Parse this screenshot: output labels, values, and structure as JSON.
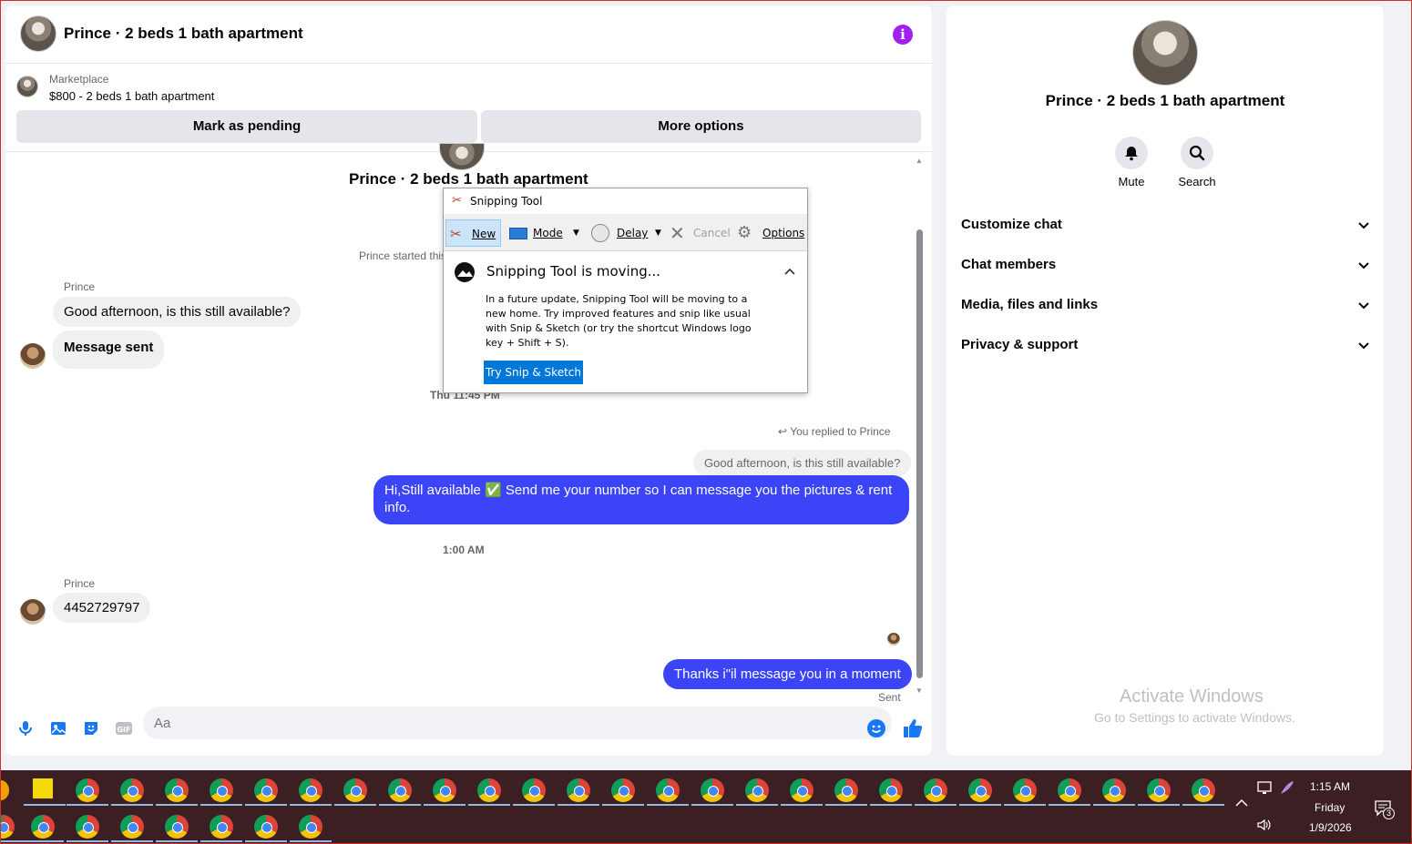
{
  "header": {
    "title": "Prince · 2 beds 1 bath apartment"
  },
  "marketplace": {
    "label": "Marketplace",
    "listing": "$800 - 2 beds 1 bath apartment",
    "mark_pending": "Mark as pending",
    "more_options": "More options"
  },
  "conversation": {
    "title": "Prince · 2 beds 1 bath apartment",
    "started_text": "Prince started this",
    "messages": {
      "sender1": "Prince",
      "msg1": "Good afternoon, is this still available?",
      "msg2": "Message sent",
      "ts1": "Thu 11:45 PM",
      "replied_label": "You replied to Prince",
      "quoted": "Good afternoon, is this still available?",
      "reply": "Hi,Still available ✅ Send me your number so I can message you the pictures & rent info.",
      "ts2": "1:00 AM",
      "sender2": "Prince",
      "msg3": "4452729797",
      "msg4": "Thanks i\"il message you in a moment",
      "sent": "Sent"
    }
  },
  "composer": {
    "placeholder": "Aa",
    "icons": [
      "microphone-icon",
      "photo-icon",
      "sticker-icon",
      "gif-icon",
      "emoji-icon",
      "like-icon"
    ]
  },
  "right_panel": {
    "title": "Prince · 2 beds 1 bath apartment",
    "mute": "Mute",
    "search": "Search",
    "sections": [
      "Customize chat",
      "Chat members",
      "Media, files and links",
      "Privacy & support"
    ]
  },
  "activate": {
    "title": "Activate Windows",
    "subtitle": "Go to Settings to activate Windows."
  },
  "snipping_tool": {
    "title": "Snipping Tool",
    "new": "New",
    "mode": "Mode",
    "delay": "Delay",
    "cancel": "Cancel",
    "options": "Options",
    "heading": "Snipping Tool is moving...",
    "body": "In a future update, Snipping Tool will be moving to a new home. Try improved features and snip like usual with Snip & Sketch (or try the shortcut Windows logo key + Shift + S).",
    "button": "Try Snip & Sketch"
  },
  "taskbar": {
    "time": "1:15 AM",
    "day": "Friday",
    "date": "1/9/2026",
    "notification_count": "3"
  },
  "colors": {
    "accent": "#3b44f6",
    "brand_blue": "#1877f2",
    "info_purple": "#a020f0",
    "taskbar": "#3b1f22"
  }
}
